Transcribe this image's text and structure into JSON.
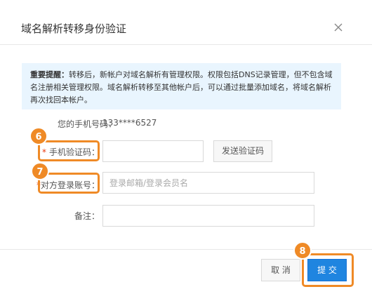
{
  "dialog": {
    "title": "域名解析转移身份验证",
    "close_icon": "close-icon"
  },
  "notice": {
    "bold_label": "重要提醒：",
    "text": "转移后，新帐户对域名解析有管理权限。权限包括DNS记录管理，但不包含域名注册相关管理权限。域名解析转移至其他帐户后，可以通过批量添加域名，将域名解析再次找回本帐户。"
  },
  "form": {
    "phone_label": "您的手机号码：",
    "phone_value": "133****6527",
    "required_mark": "*",
    "code_label": "手机验证码：",
    "code_value": "",
    "send_code_label": "发送验证码",
    "account_label": "对方登录账号：",
    "account_placeholder": "登录邮箱/登录会员名",
    "note_label": "备注：",
    "note_value": ""
  },
  "footer": {
    "cancel_label": "取 消",
    "submit_label": "提 交"
  },
  "annotations": {
    "step_6": "6",
    "step_7": "7",
    "step_8": "8",
    "highlight_color": "#ef8a26"
  },
  "colors": {
    "primary": "#1f85e0",
    "notice_bg": "#e9f5fe",
    "required": "#e8380d"
  }
}
